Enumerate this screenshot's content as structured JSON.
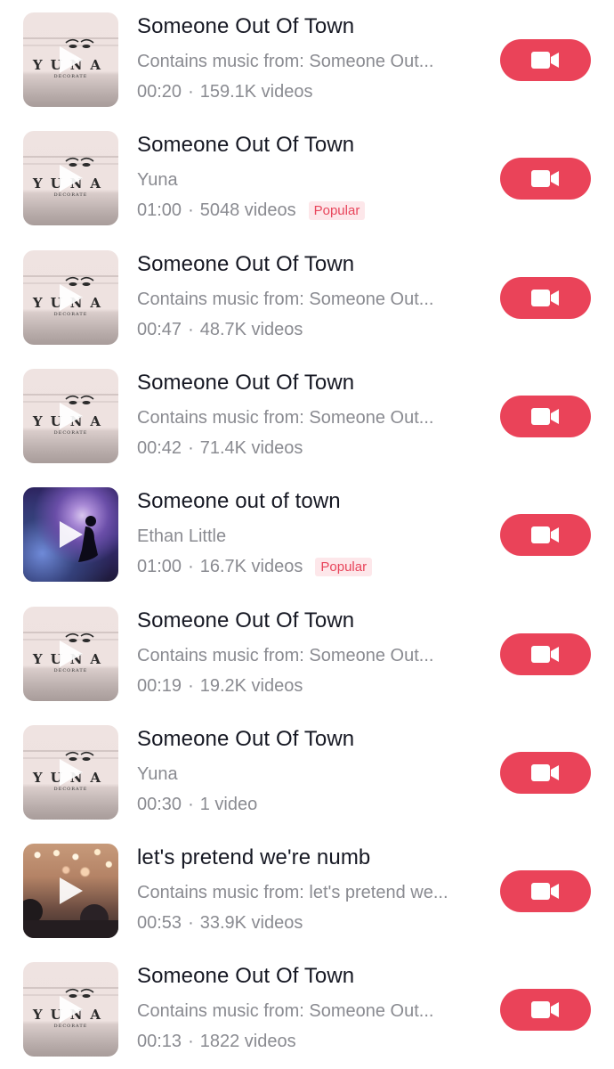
{
  "colors": {
    "accent": "#ea4359",
    "badge_bg": "#fde7ea",
    "title": "#161823",
    "secondary": "#8a8b91"
  },
  "sounds": [
    {
      "title": "Someone Out Of Town",
      "subtitle": "Contains music from: Someone Out...",
      "duration": "00:20",
      "videos": "159.1K videos",
      "badge": "",
      "art": "yuna",
      "icon": "video-camera-icon"
    },
    {
      "title": "Someone Out Of Town",
      "subtitle": "Yuna",
      "duration": "01:00",
      "videos": "5048 videos",
      "badge": "Popular",
      "art": "yuna",
      "icon": "video-camera-icon"
    },
    {
      "title": "Someone Out Of Town",
      "subtitle": "Contains music from: Someone Out...",
      "duration": "00:47",
      "videos": "48.7K videos",
      "badge": "",
      "art": "yuna",
      "icon": "video-camera-icon"
    },
    {
      "title": "Someone Out Of Town",
      "subtitle": "Contains music from: Someone Out...",
      "duration": "00:42",
      "videos": "71.4K videos",
      "badge": "",
      "art": "yuna",
      "icon": "video-camera-icon"
    },
    {
      "title": "Someone out of town",
      "subtitle": "Ethan Little",
      "duration": "01:00",
      "videos": "16.7K videos",
      "badge": "Popular",
      "art": "cosmic",
      "icon": "video-camera-icon"
    },
    {
      "title": "Someone Out Of Town",
      "subtitle": "Contains music from: Someone Out...",
      "duration": "00:19",
      "videos": "19.2K videos",
      "badge": "",
      "art": "yuna",
      "icon": "video-camera-icon"
    },
    {
      "title": "Someone Out Of Town",
      "subtitle": "Yuna",
      "duration": "00:30",
      "videos": "1 video",
      "badge": "",
      "art": "yuna",
      "icon": "video-camera-icon"
    },
    {
      "title": "let's pretend we're numb",
      "subtitle": "Contains music from: let's pretend we...",
      "duration": "00:53",
      "videos": "33.9K videos",
      "badge": "",
      "art": "concert",
      "icon": "video-camera-icon"
    },
    {
      "title": "Someone Out Of Town",
      "subtitle": "Contains music from: Someone Out...",
      "duration": "00:13",
      "videos": "1822 videos",
      "badge": "",
      "art": "yuna",
      "icon": "video-camera-icon"
    }
  ],
  "album_art_text": {
    "yuna_word": "YUNA",
    "yuna_sub": "DECORATE"
  },
  "separator": "·"
}
